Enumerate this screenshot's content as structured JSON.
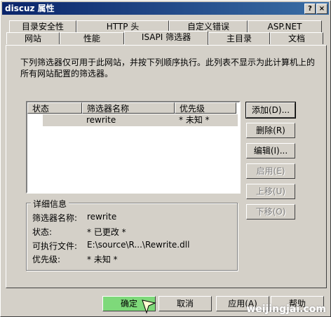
{
  "window": {
    "title": "discuz 属性",
    "help_glyph": "?",
    "close_glyph": "×"
  },
  "tabs_back": [
    "目录安全性",
    "HTTP 头",
    "自定义错误",
    "ASP.NET"
  ],
  "tabs_front": [
    "网站",
    "性能",
    "ISAPI 筛选器",
    "主目录",
    "文档"
  ],
  "description": "下列筛选器仅可用于此网站，并按下列顺序执行。此列表不显示为此计算机上的所有网站配置的筛选器。",
  "list": {
    "columns": [
      "状态",
      "筛选器名称",
      "优先级"
    ],
    "rows": [
      {
        "status": "",
        "name": "rewrite",
        "priority": "* 未知 *"
      }
    ]
  },
  "side_buttons": [
    "添加(D)...",
    "删除(R)",
    "编辑(I)...",
    "启用(E)",
    "上移(U)",
    "下移(O)"
  ],
  "details": {
    "title": "详细信息",
    "name_label": "筛选器名称:",
    "name_value": "rewrite",
    "status_label": "状态:",
    "status_value": "* 已更改 *",
    "exe_label": "可执行文件:",
    "exe_value": "E:\\source\\R...\\Rewrite.dll",
    "priority_label": "优先级:",
    "priority_value": "* 未知 *"
  },
  "bottom_buttons": {
    "ok": "确定",
    "cancel": "取消",
    "apply": "应用(A)",
    "help": "帮助"
  },
  "watermark": "weijingjai.com",
  "colors": {
    "ok_button": "#7ed97a"
  }
}
